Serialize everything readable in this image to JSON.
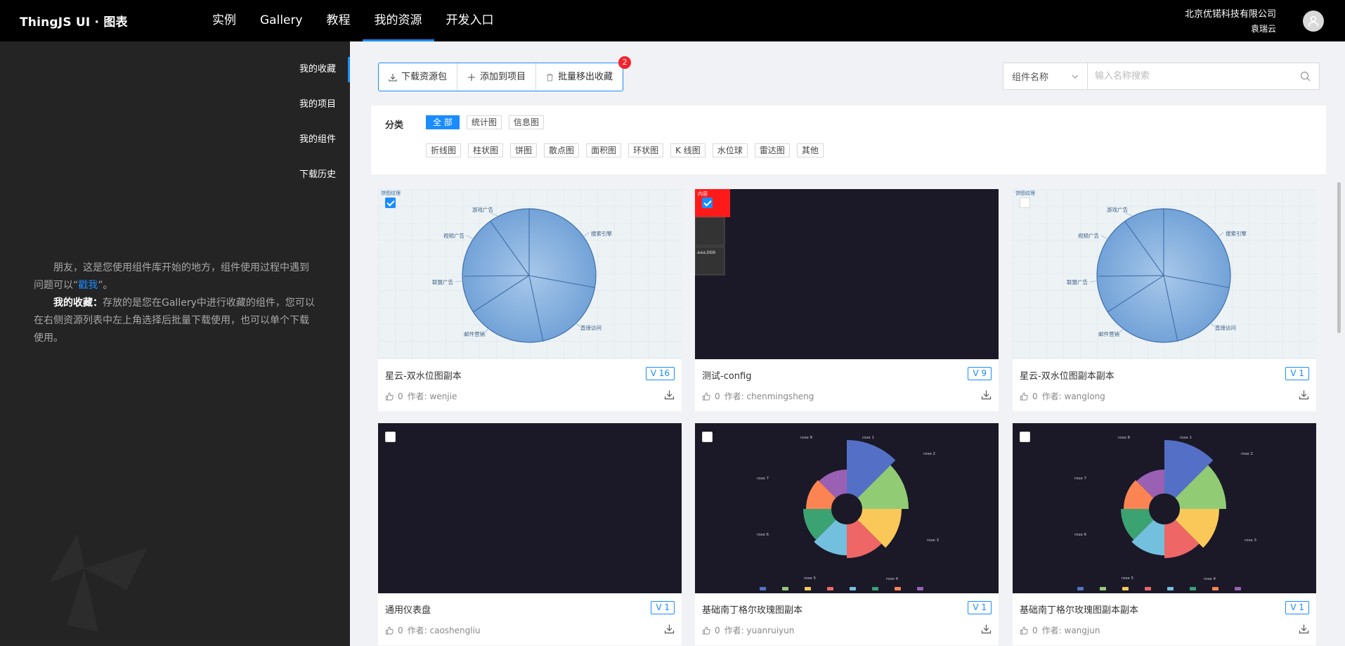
{
  "header": {
    "logo_brand": "ThingJS",
    "logo_suffix": "UI · 图表",
    "nav": [
      {
        "label": "实例"
      },
      {
        "label": "Gallery"
      },
      {
        "label": "教程"
      },
      {
        "label": "我的资源"
      },
      {
        "label": "开发入口"
      }
    ],
    "active_nav": "我的资源",
    "company": "北京优锘科技有限公司",
    "user": "袁瑞云"
  },
  "sidebar": {
    "items": [
      {
        "label": "我的收藏"
      },
      {
        "label": "我的项目"
      },
      {
        "label": "我的组件"
      },
      {
        "label": "下载历史"
      }
    ],
    "active": "我的收藏",
    "intro1_pre": "朋友，这是您使用组件库开始的地方，组件使用过程中遇到问题可以“",
    "intro1_link": "戳我",
    "intro1_post": "”。",
    "intro2_title": "我的收藏：",
    "intro2_text": "存放的是您在Gallery中进行收藏的组件，您可以在右侧资源列表中左上角选择后批量下载使用，也可以单个下载使用。"
  },
  "toolbar": {
    "download_label": "下载资源包",
    "add_label": "添加到项目",
    "remove_label": "批量移出收藏",
    "badge": "2"
  },
  "search": {
    "select_value": "组件名称",
    "placeholder": "输入名称搜索"
  },
  "filter": {
    "label": "分类",
    "row1": [
      "全 部",
      "统计图",
      "信息图"
    ],
    "row2": [
      "折线图",
      "柱状图",
      "饼图",
      "散点图",
      "面积图",
      "环状图",
      "K 线图",
      "水位球",
      "雷达图",
      "其他"
    ]
  },
  "cards": [
    {
      "name": "星云-双水位图副本",
      "version": "V 16",
      "likes": "0",
      "author": "作者: wenjie",
      "checked": true,
      "thumb": "pie-light",
      "thumb_title": "饼图纹理"
    },
    {
      "name": "测试-config",
      "version": "V 9",
      "likes": "0",
      "author": "作者: chenmingsheng",
      "checked": true,
      "thumb": "dark-config",
      "thumb_title": "内容",
      "thumb_text": "aaa,bbb"
    },
    {
      "name": "星云-双水位图副本副本",
      "version": "V 1",
      "likes": "0",
      "author": "作者: wanglong",
      "checked": false,
      "thumb": "pie-light",
      "thumb_title": "饼图纹理"
    },
    {
      "name": "通用仪表盘",
      "version": "V 1",
      "likes": "0",
      "author": "作者: caoshengliu",
      "checked": false,
      "thumb": "dark-empty"
    },
    {
      "name": "基础南丁格尔玫瑰图副本",
      "version": "V 1",
      "likes": "0",
      "author": "作者: yuanruiyun",
      "checked": false,
      "thumb": "rose"
    },
    {
      "name": "基础南丁格尔玫瑰图副本副本",
      "version": "V 1",
      "likes": "0",
      "author": "作者: wangjun",
      "checked": false,
      "thumb": "rose"
    }
  ],
  "pie_labels": [
    "游戏广告",
    "搜索引擎",
    "视频广告",
    "联盟广告",
    "邮件营销",
    "直接访问"
  ],
  "rose_labels": [
    "rose 1",
    "rose 2",
    "rose 3",
    "rose 4",
    "rose 5",
    "rose 6",
    "rose 7",
    "rose 8"
  ],
  "colors": {
    "accent": "#1a8cff",
    "rose": [
      "#5470c6",
      "#91cc75",
      "#fac858",
      "#ee6666",
      "#73c0de",
      "#3ba272",
      "#fc8452",
      "#9a60b4"
    ]
  }
}
